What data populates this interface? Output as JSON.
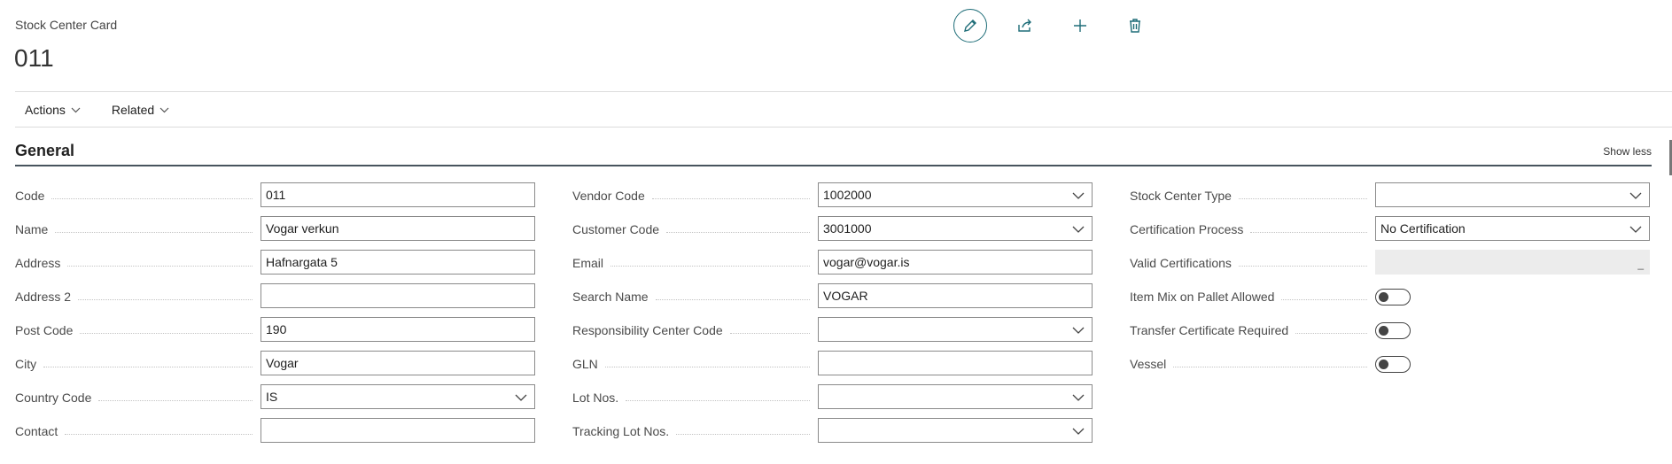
{
  "page": {
    "caption": "Stock Center Card",
    "record_no": "011"
  },
  "toolbar": {
    "icons": [
      "pencil-icon",
      "share-icon",
      "plus-icon",
      "trash-icon"
    ]
  },
  "menu": {
    "actions": "Actions",
    "related": "Related"
  },
  "section": {
    "title": "General",
    "show_less": "Show less"
  },
  "col1": [
    {
      "label": "Code",
      "value": "011",
      "type": "text"
    },
    {
      "label": "Name",
      "value": "Vogar verkun",
      "type": "text"
    },
    {
      "label": "Address",
      "value": "Hafnargata 5",
      "type": "text"
    },
    {
      "label": "Address 2",
      "value": "",
      "type": "text"
    },
    {
      "label": "Post Code",
      "value": "190",
      "type": "text"
    },
    {
      "label": "City",
      "value": "Vogar",
      "type": "text"
    },
    {
      "label": "Country Code",
      "value": "IS",
      "type": "select"
    },
    {
      "label": "Contact",
      "value": "",
      "type": "text"
    }
  ],
  "col2": [
    {
      "label": "Vendor Code",
      "value": "1002000",
      "type": "select"
    },
    {
      "label": "Customer Code",
      "value": "3001000",
      "type": "select"
    },
    {
      "label": "Email",
      "value": "vogar@vogar.is",
      "type": "text"
    },
    {
      "label": "Search Name",
      "value": "VOGAR",
      "type": "text"
    },
    {
      "label": "Responsibility Center Code",
      "value": "",
      "type": "select"
    },
    {
      "label": "GLN",
      "value": "",
      "type": "text"
    },
    {
      "label": "Lot Nos.",
      "value": "",
      "type": "select"
    },
    {
      "label": "Tracking Lot Nos.",
      "value": "",
      "type": "select"
    }
  ],
  "col3": [
    {
      "label": "Stock Center Type",
      "value": "",
      "type": "select"
    },
    {
      "label": "Certification Process",
      "value": "No Certification",
      "type": "select"
    },
    {
      "label": "Valid Certifications",
      "value": "",
      "type": "readonly",
      "marker": "_"
    },
    {
      "label": "Item Mix on Pallet Allowed",
      "value": "off",
      "type": "toggle"
    },
    {
      "label": "Transfer Certificate Required",
      "value": "off",
      "type": "toggle"
    },
    {
      "label": "Vessel",
      "value": "off",
      "type": "toggle"
    }
  ]
}
